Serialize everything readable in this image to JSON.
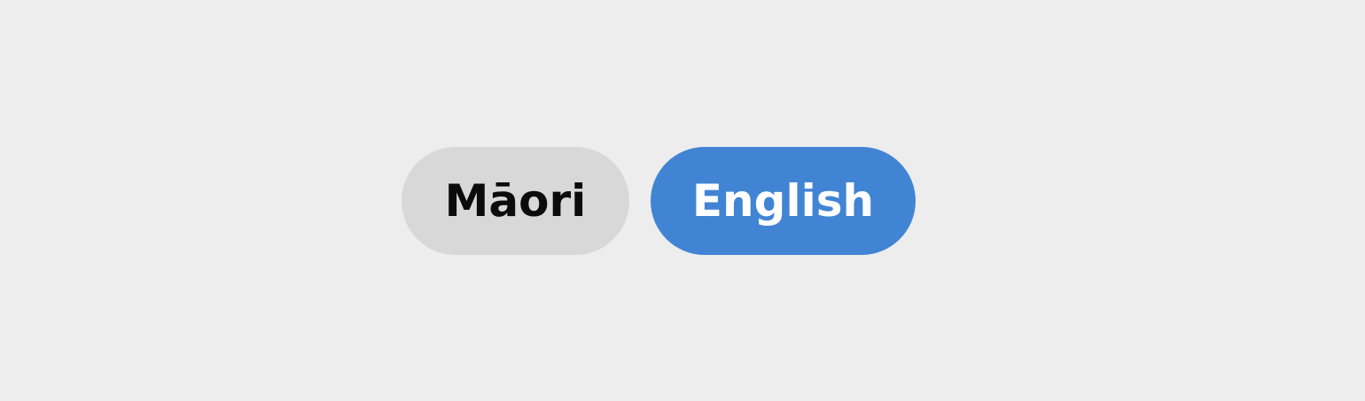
{
  "language_toggle": {
    "options": [
      {
        "label": "Māori",
        "selected": false
      },
      {
        "label": "English",
        "selected": true
      }
    ]
  },
  "colors": {
    "background": "#ededed",
    "inactive_bg": "#d8d8d8",
    "inactive_text": "#0b0b0b",
    "active_bg": "#4284d4",
    "active_text": "#ffffff"
  }
}
